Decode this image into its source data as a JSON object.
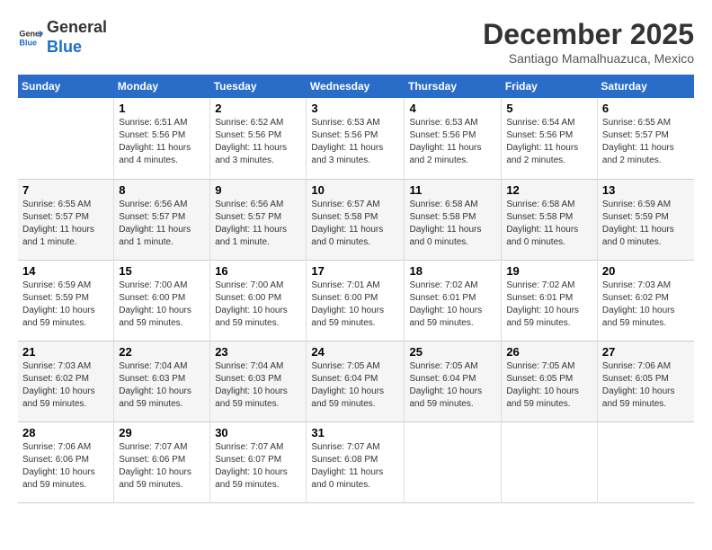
{
  "header": {
    "logo_line1": "General",
    "logo_line2": "Blue",
    "month_title": "December 2025",
    "subtitle": "Santiago Mamalhuazuca, Mexico"
  },
  "weekdays": [
    "Sunday",
    "Monday",
    "Tuesday",
    "Wednesday",
    "Thursday",
    "Friday",
    "Saturday"
  ],
  "weeks": [
    [
      {
        "day": "",
        "text": ""
      },
      {
        "day": "1",
        "text": "Sunrise: 6:51 AM\nSunset: 5:56 PM\nDaylight: 11 hours\nand 4 minutes."
      },
      {
        "day": "2",
        "text": "Sunrise: 6:52 AM\nSunset: 5:56 PM\nDaylight: 11 hours\nand 3 minutes."
      },
      {
        "day": "3",
        "text": "Sunrise: 6:53 AM\nSunset: 5:56 PM\nDaylight: 11 hours\nand 3 minutes."
      },
      {
        "day": "4",
        "text": "Sunrise: 6:53 AM\nSunset: 5:56 PM\nDaylight: 11 hours\nand 2 minutes."
      },
      {
        "day": "5",
        "text": "Sunrise: 6:54 AM\nSunset: 5:56 PM\nDaylight: 11 hours\nand 2 minutes."
      },
      {
        "day": "6",
        "text": "Sunrise: 6:55 AM\nSunset: 5:57 PM\nDaylight: 11 hours\nand 2 minutes."
      }
    ],
    [
      {
        "day": "7",
        "text": "Sunrise: 6:55 AM\nSunset: 5:57 PM\nDaylight: 11 hours\nand 1 minute."
      },
      {
        "day": "8",
        "text": "Sunrise: 6:56 AM\nSunset: 5:57 PM\nDaylight: 11 hours\nand 1 minute."
      },
      {
        "day": "9",
        "text": "Sunrise: 6:56 AM\nSunset: 5:57 PM\nDaylight: 11 hours\nand 1 minute."
      },
      {
        "day": "10",
        "text": "Sunrise: 6:57 AM\nSunset: 5:58 PM\nDaylight: 11 hours\nand 0 minutes."
      },
      {
        "day": "11",
        "text": "Sunrise: 6:58 AM\nSunset: 5:58 PM\nDaylight: 11 hours\nand 0 minutes."
      },
      {
        "day": "12",
        "text": "Sunrise: 6:58 AM\nSunset: 5:58 PM\nDaylight: 11 hours\nand 0 minutes."
      },
      {
        "day": "13",
        "text": "Sunrise: 6:59 AM\nSunset: 5:59 PM\nDaylight: 11 hours\nand 0 minutes."
      }
    ],
    [
      {
        "day": "14",
        "text": "Sunrise: 6:59 AM\nSunset: 5:59 PM\nDaylight: 10 hours\nand 59 minutes."
      },
      {
        "day": "15",
        "text": "Sunrise: 7:00 AM\nSunset: 6:00 PM\nDaylight: 10 hours\nand 59 minutes."
      },
      {
        "day": "16",
        "text": "Sunrise: 7:00 AM\nSunset: 6:00 PM\nDaylight: 10 hours\nand 59 minutes."
      },
      {
        "day": "17",
        "text": "Sunrise: 7:01 AM\nSunset: 6:00 PM\nDaylight: 10 hours\nand 59 minutes."
      },
      {
        "day": "18",
        "text": "Sunrise: 7:02 AM\nSunset: 6:01 PM\nDaylight: 10 hours\nand 59 minutes."
      },
      {
        "day": "19",
        "text": "Sunrise: 7:02 AM\nSunset: 6:01 PM\nDaylight: 10 hours\nand 59 minutes."
      },
      {
        "day": "20",
        "text": "Sunrise: 7:03 AM\nSunset: 6:02 PM\nDaylight: 10 hours\nand 59 minutes."
      }
    ],
    [
      {
        "day": "21",
        "text": "Sunrise: 7:03 AM\nSunset: 6:02 PM\nDaylight: 10 hours\nand 59 minutes."
      },
      {
        "day": "22",
        "text": "Sunrise: 7:04 AM\nSunset: 6:03 PM\nDaylight: 10 hours\nand 59 minutes."
      },
      {
        "day": "23",
        "text": "Sunrise: 7:04 AM\nSunset: 6:03 PM\nDaylight: 10 hours\nand 59 minutes."
      },
      {
        "day": "24",
        "text": "Sunrise: 7:05 AM\nSunset: 6:04 PM\nDaylight: 10 hours\nand 59 minutes."
      },
      {
        "day": "25",
        "text": "Sunrise: 7:05 AM\nSunset: 6:04 PM\nDaylight: 10 hours\nand 59 minutes."
      },
      {
        "day": "26",
        "text": "Sunrise: 7:05 AM\nSunset: 6:05 PM\nDaylight: 10 hours\nand 59 minutes."
      },
      {
        "day": "27",
        "text": "Sunrise: 7:06 AM\nSunset: 6:05 PM\nDaylight: 10 hours\nand 59 minutes."
      }
    ],
    [
      {
        "day": "28",
        "text": "Sunrise: 7:06 AM\nSunset: 6:06 PM\nDaylight: 10 hours\nand 59 minutes."
      },
      {
        "day": "29",
        "text": "Sunrise: 7:07 AM\nSunset: 6:06 PM\nDaylight: 10 hours\nand 59 minutes."
      },
      {
        "day": "30",
        "text": "Sunrise: 7:07 AM\nSunset: 6:07 PM\nDaylight: 10 hours\nand 59 minutes."
      },
      {
        "day": "31",
        "text": "Sunrise: 7:07 AM\nSunset: 6:08 PM\nDaylight: 11 hours\nand 0 minutes."
      },
      {
        "day": "",
        "text": ""
      },
      {
        "day": "",
        "text": ""
      },
      {
        "day": "",
        "text": ""
      }
    ]
  ]
}
